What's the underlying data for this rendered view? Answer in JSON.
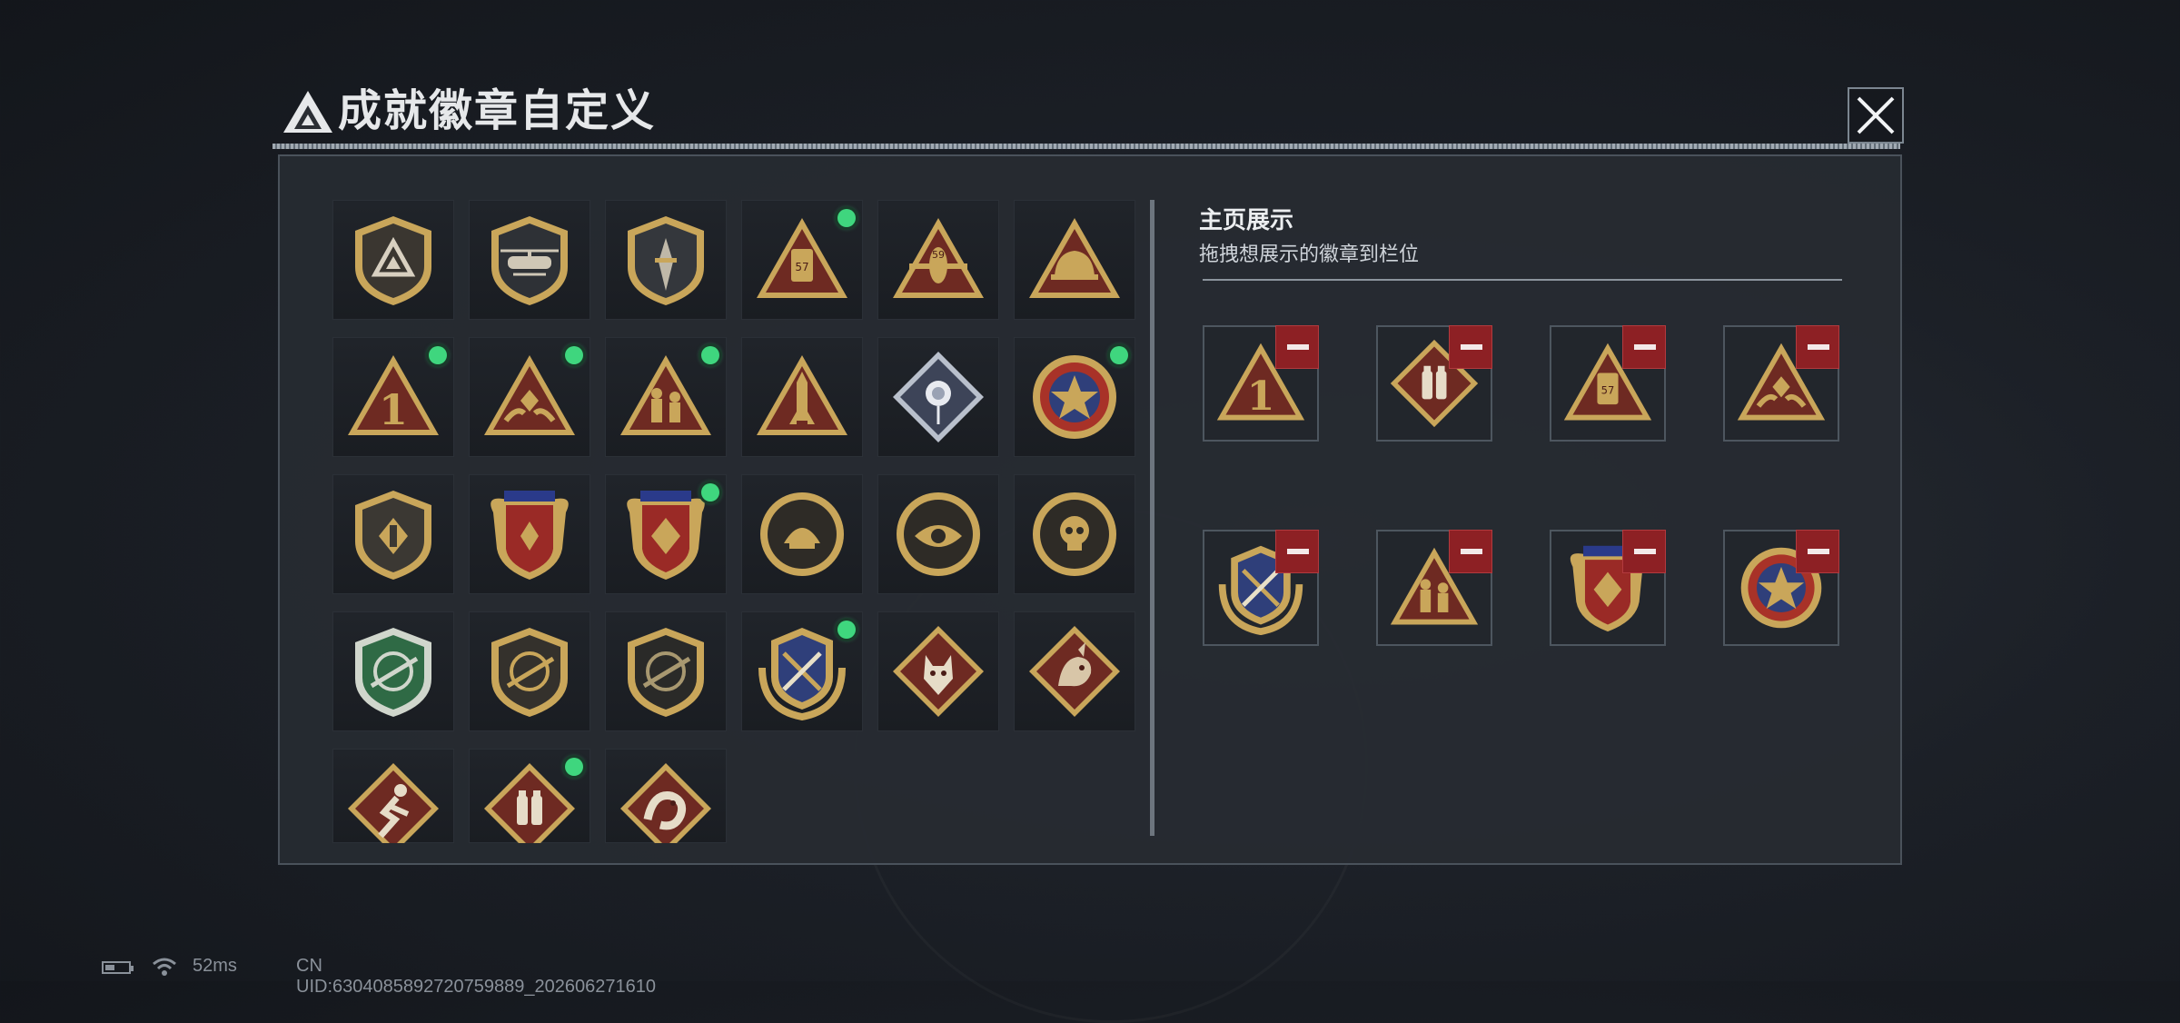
{
  "dialog": {
    "title": "成就徽章自定义"
  },
  "badges": [
    {
      "icon": "shield-triangle-emblem-icon",
      "new": false
    },
    {
      "icon": "shield-helicopter-emblem-icon",
      "new": false
    },
    {
      "icon": "shield-dagger-emblem-icon",
      "new": false
    },
    {
      "icon": "triangle-57-canister-icon",
      "new": true
    },
    {
      "icon": "triangle-59-aircraft-icon",
      "new": false
    },
    {
      "icon": "triangle-helmet-icon",
      "new": false
    },
    {
      "icon": "triangle-number-one-icon",
      "new": true
    },
    {
      "icon": "triangle-hands-diamond-icon",
      "new": true
    },
    {
      "icon": "triangle-soldiers-icon",
      "new": true
    },
    {
      "icon": "triangle-rocket-icon",
      "new": false
    },
    {
      "icon": "diamond-rose-icon",
      "new": false
    },
    {
      "icon": "round-star-medal-icon",
      "new": true
    },
    {
      "icon": "shield-hand-emblem-icon",
      "new": false
    },
    {
      "icon": "winged-shield-ribbon-icon",
      "new": false
    },
    {
      "icon": "winged-shield-diamond-icon",
      "new": true
    },
    {
      "icon": "round-shell-medal-icon",
      "new": false
    },
    {
      "icon": "round-eye-medal-icon",
      "new": false
    },
    {
      "icon": "round-skull-medal-icon",
      "new": false
    },
    {
      "icon": "green-shield-rifle-icon",
      "new": false
    },
    {
      "icon": "shield-rifle-icon",
      "new": false
    },
    {
      "icon": "dark-shield-rifle-icon",
      "new": false
    },
    {
      "icon": "laurel-shield-swords-icon",
      "new": true
    },
    {
      "icon": "diamond-wolf-icon",
      "new": false
    },
    {
      "icon": "diamond-dragon-icon",
      "new": false
    },
    {
      "icon": "diamond-runner-icon",
      "new": false
    },
    {
      "icon": "diamond-bottles-icon",
      "new": true
    },
    {
      "icon": "diamond-serpent-icon",
      "new": false
    }
  ],
  "showcase": {
    "title": "主页展示",
    "subtitle": "拖拽想展示的徽章到栏位",
    "slots": [
      {
        "icon": "triangle-number-one-icon"
      },
      {
        "icon": "diamond-bottles-icon"
      },
      {
        "icon": "triangle-57-canister-icon"
      },
      {
        "icon": "triangle-hands-diamond-icon"
      },
      {
        "icon": "laurel-shield-swords-icon"
      },
      {
        "icon": "triangle-soldiers-icon"
      },
      {
        "icon": "winged-shield-diamond-icon"
      },
      {
        "icon": "round-star-medal-icon"
      }
    ]
  },
  "status": {
    "ping": "52ms",
    "uid": "CN UID:6304085892720759889_202606271610"
  },
  "colors": {
    "accent_green": "#3fd67e",
    "remove_red": "#8d2024",
    "gold": "#c9a65a",
    "maroon": "#6e2a22"
  }
}
